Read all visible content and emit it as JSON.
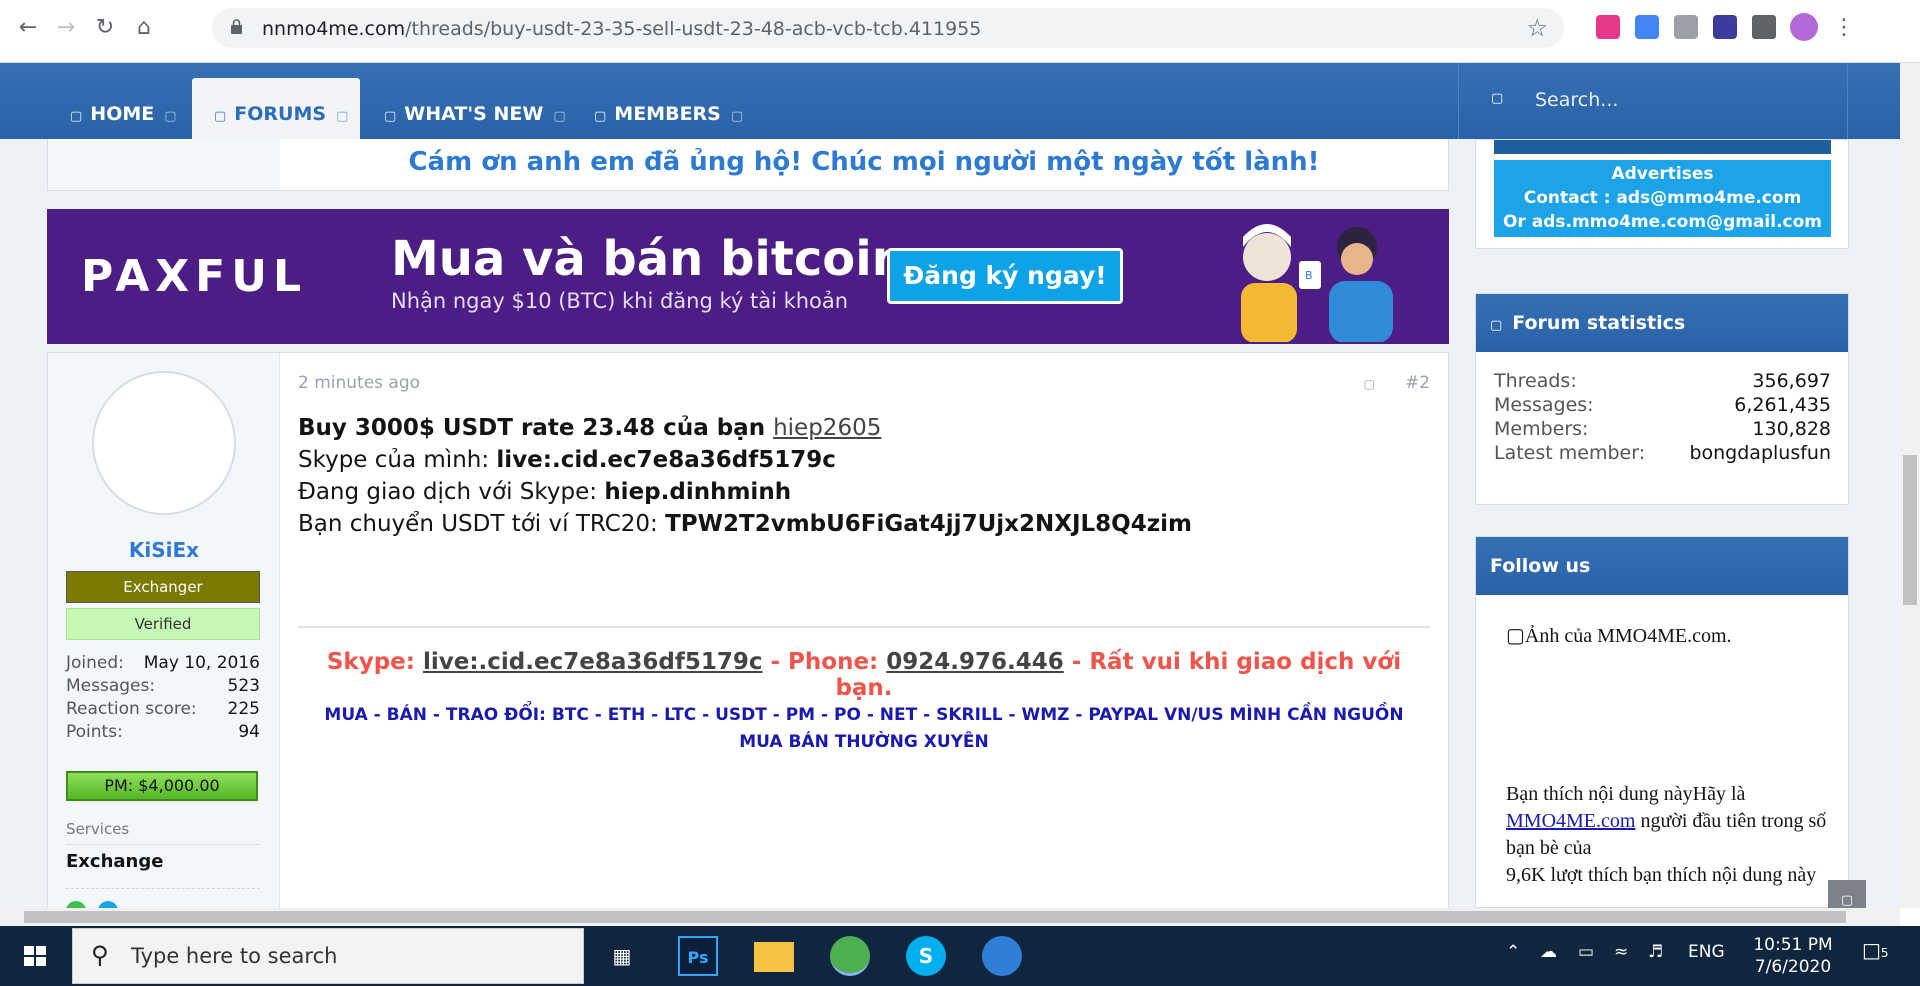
{
  "browser": {
    "url_host": "nnmo4me.com",
    "url_path": "/threads/buy-usdt-23-35-sell-usdt-23-48-acb-vcb-tcb.411955",
    "back_icon": "arrow-left-icon",
    "forward_icon": "arrow-right-icon",
    "reload_icon": "reload-icon",
    "home_icon": "home-icon",
    "bookmark_icon": "star-icon",
    "menu_icon": "kebab-menu-icon"
  },
  "nav": {
    "items": [
      "HOME",
      "FORUMS",
      "WHAT'S NEW",
      "MEMBERS"
    ],
    "search_placeholder": "Search..."
  },
  "thanks": "Cám ơn anh em đã ủng hộ! Chúc mọi người một ngày tốt lành!",
  "ad": {
    "logo": "PAXFUL",
    "headline": "Mua và bán bitcoin",
    "subline": "Nhận ngay $10 (BTC) khi đăng ký tài khoản",
    "cta": "Đăng ký ngay!",
    "bubble": "B"
  },
  "post": {
    "user": {
      "name": "KiSiEx",
      "badge": "Exchanger",
      "verified": "Verified",
      "stats": [
        {
          "label": "Joined:",
          "value": "May 10, 2016"
        },
        {
          "label": "Messages:",
          "value": "523"
        },
        {
          "label": "Reaction score:",
          "value": "225"
        },
        {
          "label": "Points:",
          "value": "94"
        }
      ],
      "pm": "PM: $4,000.00",
      "services_label": "Services",
      "services_value": "Exchange"
    },
    "time": "2 minutes ago",
    "number": "#2",
    "line1_pre": "Buy 3000$ USDT rate 23.48 của bạn ",
    "line1_user": "hiep2605",
    "line2_pre": "Skype của mình: ",
    "line2_val": "live:.cid.ec7e8a36df5179c",
    "line3_pre": "Đang giao dịch với Skype: ",
    "line3_val": "hiep.dinhminh",
    "line4_pre": "Bạn chuyển USDT tới ví TRC20: ",
    "line4_val": "TPW2T2vmbU6FiGat4jj7Ujx2NXJL8Q4zim",
    "sig_skype_label": "Skype: ",
    "sig_skype": "live:.cid.ec7e8a36df5179c",
    "sig_phone_label": " - Phone: ",
    "sig_phone": "0924.976.446",
    "sig_tail": " - Rất vui khi giao dịch với bạn.",
    "sig2": "MUA - BÁN - TRAO ĐỔI: BTC - ETH - LTC - USDT - PM - PO - NET - SKRILL - WMZ - PAYPAL VN/US MÌNH CẦN NGUỒN MUA BÁN THƯỜNG XUYÊN"
  },
  "sidebar": {
    "ads_lines": [
      "Advertises",
      "Contact : ads@mmo4me.com",
      "Or ads.mmo4me.com@gmail.com"
    ],
    "stats_title": "Forum statistics",
    "stats": [
      {
        "label": "Threads:",
        "value": "356,697"
      },
      {
        "label": "Messages:",
        "value": "6,261,435"
      },
      {
        "label": "Members:",
        "value": "130,828"
      },
      {
        "label": "Latest member:",
        "value": "bongdaplusfun"
      }
    ],
    "follow_title": "Follow us",
    "follow_img_alt": "Ảnh của MMO4ME.com.",
    "follow_text1": "Bạn thích nội dung nàyHãy là",
    "follow_link": "MMO4ME.com",
    "follow_text2": "người đầu tiên trong số bạn bè của",
    "follow_text3": "9,6K lượt thích",
    "follow_text4": "bạn thích nội dung này"
  },
  "taskbar": {
    "search": "Type here to search",
    "lang": "ENG",
    "time": "10:51 PM",
    "date": "7/6/2020",
    "notif_count": "5"
  }
}
